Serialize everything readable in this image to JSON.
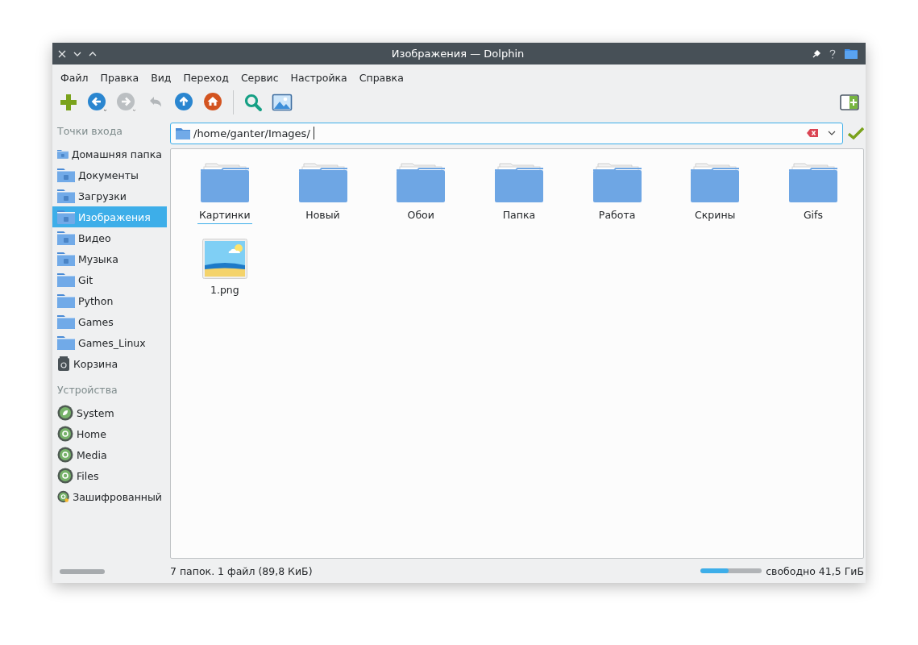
{
  "window": {
    "title": "Изображения — Dolphin"
  },
  "menu": [
    "Файл",
    "Правка",
    "Вид",
    "Переход",
    "Сервис",
    "Настройка",
    "Справка"
  ],
  "toolbar": {
    "navigation": [
      {
        "kind": "add",
        "disabled": false,
        "dropdown": false
      },
      {
        "kind": "back",
        "disabled": false,
        "dropdown": true
      },
      {
        "kind": "forward",
        "disabled": true,
        "dropdown": true
      },
      {
        "kind": "undo",
        "disabled": true,
        "dropdown": false
      },
      {
        "kind": "up",
        "disabled": false,
        "dropdown": false
      },
      {
        "kind": "home",
        "disabled": false,
        "dropdown": false
      }
    ],
    "view": [
      {
        "kind": "search"
      },
      {
        "kind": "preview"
      }
    ]
  },
  "sidebar": {
    "places_heading": "Точки входа",
    "places": [
      {
        "label": "Домашняя папка",
        "kind": "home",
        "selected": false
      },
      {
        "label": "Документы",
        "kind": "documents",
        "selected": false
      },
      {
        "label": "Загрузки",
        "kind": "downloads",
        "selected": false
      },
      {
        "label": "Изображения",
        "kind": "pictures",
        "selected": true
      },
      {
        "label": "Видео",
        "kind": "videos",
        "selected": false
      },
      {
        "label": "Музыка",
        "kind": "music",
        "selected": false
      },
      {
        "label": "Git",
        "kind": "folder",
        "selected": false
      },
      {
        "label": "Python",
        "kind": "folder",
        "selected": false
      },
      {
        "label": "Games",
        "kind": "folder",
        "selected": false
      },
      {
        "label": "Games_Linux",
        "kind": "folder",
        "selected": false
      },
      {
        "label": "Корзина",
        "kind": "trash",
        "selected": false
      }
    ],
    "devices_heading": "Устройства",
    "devices": [
      {
        "label": "System",
        "kind": "system",
        "encrypted": false
      },
      {
        "label": "Home",
        "kind": "drive",
        "encrypted": false
      },
      {
        "label": "Media",
        "kind": "drive",
        "encrypted": false
      },
      {
        "label": "Files",
        "kind": "drive",
        "encrypted": false
      },
      {
        "label": "Зашифрованный",
        "kind": "drive",
        "encrypted": true
      }
    ]
  },
  "location": {
    "value": "/home/ganter/Images/"
  },
  "items": [
    {
      "name": "Картинки",
      "kind": "folder",
      "focused": true
    },
    {
      "name": "Новый",
      "kind": "folder",
      "focused": false
    },
    {
      "name": "Обои",
      "kind": "folder",
      "focused": false
    },
    {
      "name": "Папка",
      "kind": "folder",
      "focused": false
    },
    {
      "name": "Работа",
      "kind": "folder",
      "focused": false
    },
    {
      "name": "Скрины",
      "kind": "folder",
      "focused": false
    },
    {
      "name": "Gifs",
      "kind": "folder",
      "focused": false
    },
    {
      "name": "1.png",
      "kind": "image",
      "focused": false
    }
  ],
  "status_bar": {
    "summary": "7 папок. 1 файл (89,8 КиБ)",
    "free_space": {
      "level": 0.46,
      "label": "свободно 41,5 ГиБ"
    }
  }
}
